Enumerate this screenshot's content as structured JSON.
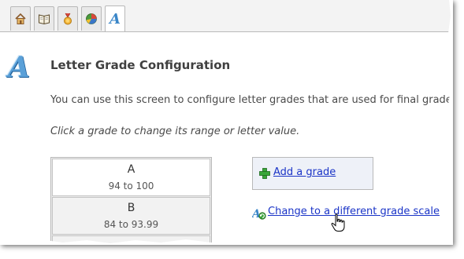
{
  "tabs": [
    {
      "icon": "home-icon"
    },
    {
      "icon": "book-icon"
    },
    {
      "icon": "medal-icon"
    },
    {
      "icon": "pie-chart-icon"
    },
    {
      "icon": "letter-a-icon",
      "glyph": "A",
      "active": true
    }
  ],
  "page": {
    "logo_glyph": "A",
    "title": "Letter Grade Configuration",
    "description": "You can use this screen to configure letter grades that are used for final grades",
    "instruction": "Click a grade to change its range or letter value."
  },
  "grades": [
    {
      "letter": "A",
      "range": "94 to 100"
    },
    {
      "letter": "B",
      "range": "84 to 93.99"
    }
  ],
  "actions": {
    "add_grade": "Add a grade",
    "change_scale": "Change to a different grade scale"
  },
  "colors": {
    "link": "#1a34c7",
    "accent_blue": "#3a86c8",
    "add_box_bg": "#eef1f8"
  }
}
